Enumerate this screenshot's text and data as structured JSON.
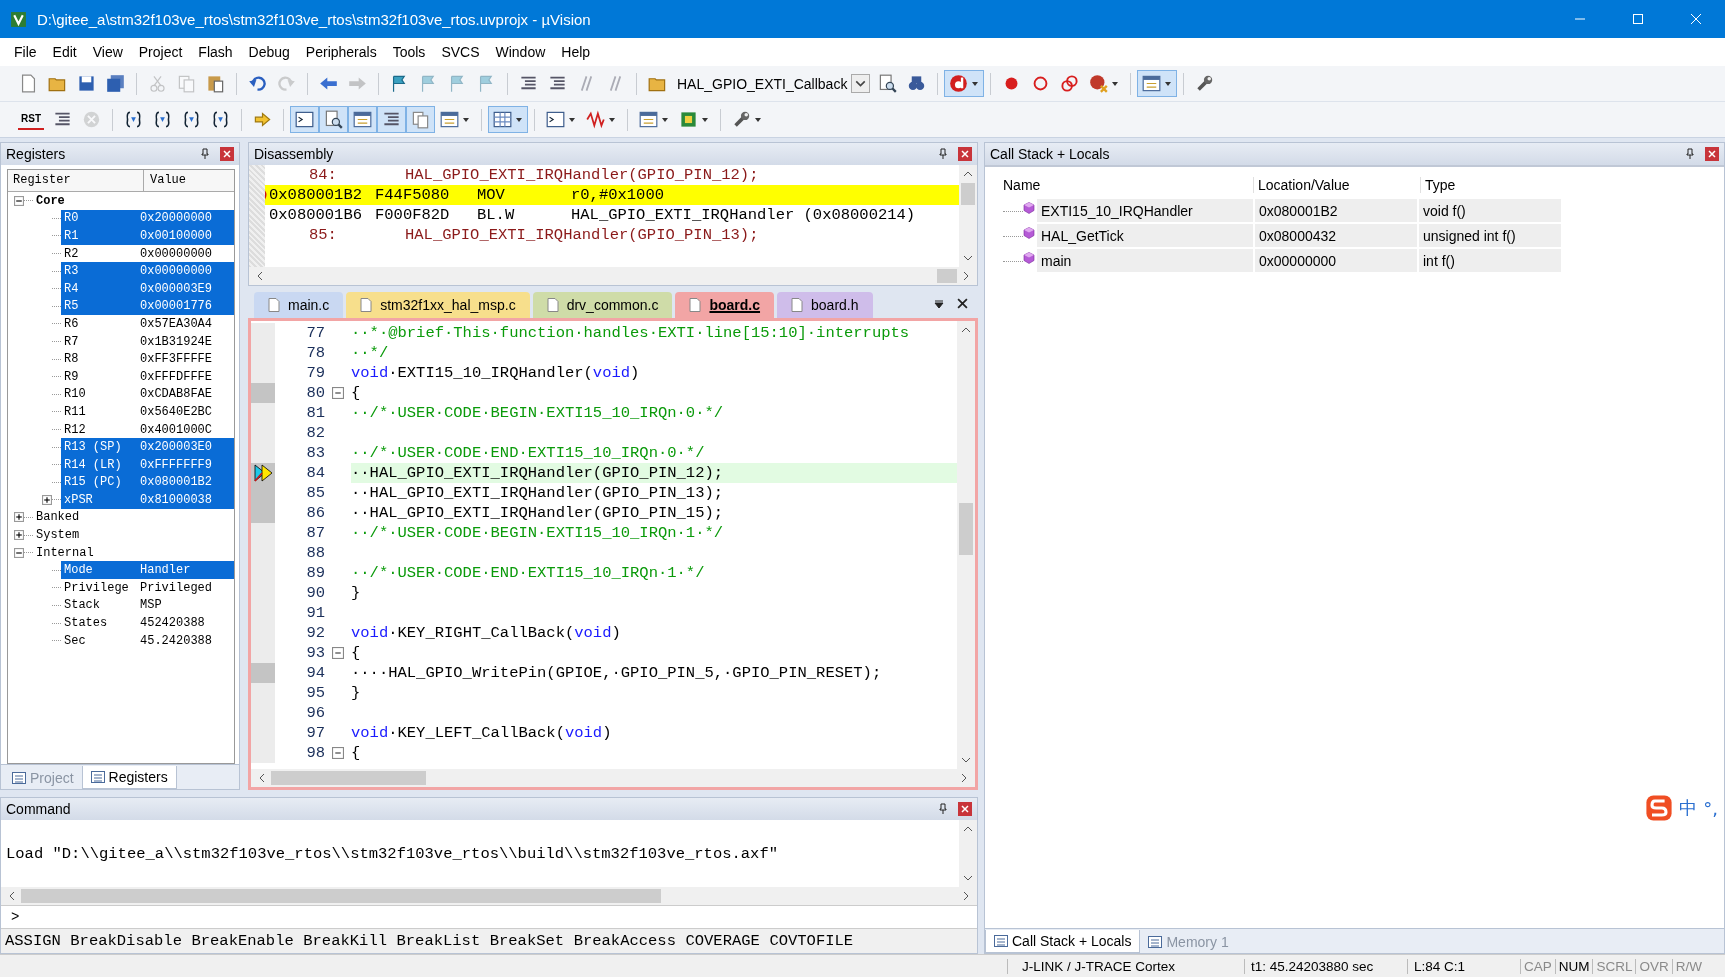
{
  "window": {
    "title": "D:\\gitee_a\\stm32f103ve_rtos\\stm32f103ve_rtos\\stm32f103ve_rtos.uvprojx - µVision"
  },
  "menu": [
    "File",
    "Edit",
    "View",
    "Project",
    "Flash",
    "Debug",
    "Peripherals",
    "Tools",
    "SVCS",
    "Window",
    "Help"
  ],
  "toolbar": {
    "function_combo": "HAL_GPIO_EXTI_Callback",
    "reset_label": "RST"
  },
  "registers": {
    "title": "Registers",
    "columns": [
      "Register",
      "Value"
    ],
    "tree": [
      {
        "name": "Core",
        "bold": true,
        "expanded": true,
        "selected": false,
        "children": [
          {
            "name": "R0",
            "value": "0x20000000",
            "selected": true
          },
          {
            "name": "R1",
            "value": "0x00100000",
            "selected": true
          },
          {
            "name": "R2",
            "value": "0x00000000",
            "selected": false
          },
          {
            "name": "R3",
            "value": "0x00000000",
            "selected": true
          },
          {
            "name": "R4",
            "value": "0x000003E9",
            "selected": true
          },
          {
            "name": "R5",
            "value": "0x00001776",
            "selected": true
          },
          {
            "name": "R6",
            "value": "0x57EA30A4",
            "selected": false
          },
          {
            "name": "R7",
            "value": "0x1B31924E",
            "selected": false
          },
          {
            "name": "R8",
            "value": "0xFF3FFFFE",
            "selected": false
          },
          {
            "name": "R9",
            "value": "0xFFFDFFFE",
            "selected": false
          },
          {
            "name": "R10",
            "value": "0xCDAB8FAE",
            "selected": false
          },
          {
            "name": "R11",
            "value": "0x5640E2BC",
            "selected": false
          },
          {
            "name": "R12",
            "value": "0x4001000C",
            "selected": false
          },
          {
            "name": "R13 (SP)",
            "value": "0x200003E0",
            "selected": true
          },
          {
            "name": "R14 (LR)",
            "value": "0xFFFFFFF9",
            "selected": true
          },
          {
            "name": "R15 (PC)",
            "value": "0x080001B2",
            "selected": true
          },
          {
            "name": "xPSR",
            "value": "0x81000038",
            "selected": true,
            "expanded": false
          }
        ]
      },
      {
        "name": "Banked",
        "bold": false,
        "expanded": false,
        "selected": false
      },
      {
        "name": "System",
        "bold": false,
        "expanded": false,
        "selected": false
      },
      {
        "name": "Internal",
        "bold": false,
        "expanded": true,
        "selected": false,
        "children": [
          {
            "name": "Mode",
            "value": "Handler",
            "selected": true
          },
          {
            "name": "Privilege",
            "value": "Privileged",
            "selected": false
          },
          {
            "name": "Stack",
            "value": "MSP",
            "selected": false
          },
          {
            "name": "States",
            "value": "452420388",
            "selected": false
          },
          {
            "name": "Sec",
            "value": "45.2420388",
            "selected": false
          }
        ]
      }
    ],
    "tabs": [
      {
        "label": "Project",
        "selected": false
      },
      {
        "label": "Registers",
        "selected": true
      }
    ]
  },
  "disassembly": {
    "title": "Disassembly",
    "lines": [
      {
        "kind": "source",
        "number": "84:",
        "text": "HAL_GPIO_EXTI_IRQHandler(GPIO_PIN_12);",
        "current": false
      },
      {
        "kind": "asm",
        "address": "0x080001B2",
        "opcode": "F44F5080",
        "mnemonic": "MOV",
        "operands": "r0,#0x1000",
        "current": true
      },
      {
        "kind": "asm",
        "address": "0x080001B6",
        "opcode": "F000F82D",
        "mnemonic": "BL.W",
        "operands": "HAL_GPIO_EXTI_IRQHandler (0x08000214)",
        "current": false
      },
      {
        "kind": "source",
        "number": "85:",
        "text": "HAL_GPIO_EXTI_IRQHandler(GPIO_PIN_13);",
        "current": false
      }
    ]
  },
  "editor": {
    "tabs": [
      {
        "label": "main.c",
        "color": "#c9d8f2",
        "selected": false
      },
      {
        "label": "stm32f1xx_hal_msp.c",
        "color": "#f7df8c",
        "selected": false
      },
      {
        "label": "drv_common.c",
        "color": "#cfdca8",
        "selected": false
      },
      {
        "label": "board.c",
        "color": "#f2a5a5",
        "selected": true
      },
      {
        "label": "board.h",
        "color": "#cfbdea",
        "selected": false
      }
    ],
    "lines": [
      {
        "number": "77",
        "executable": false,
        "fold": false,
        "current": false,
        "segments": [
          {
            "kind": "comment",
            "text": "··*·@brief·This·function·handles·EXTI·line[15:10]·interrupts"
          }
        ]
      },
      {
        "number": "78",
        "executable": false,
        "fold": false,
        "current": false,
        "segments": [
          {
            "kind": "comment",
            "text": "··*/"
          }
        ]
      },
      {
        "number": "79",
        "executable": false,
        "fold": false,
        "current": false,
        "segments": [
          {
            "kind": "keyword",
            "text": "void"
          },
          {
            "kind": "plain",
            "text": "·EXTI15_10_IRQHandler("
          },
          {
            "kind": "keyword",
            "text": "void"
          },
          {
            "kind": "plain",
            "text": ")"
          }
        ]
      },
      {
        "number": "80",
        "executable": true,
        "fold": true,
        "current": false,
        "segments": [
          {
            "kind": "plain",
            "text": "{"
          }
        ]
      },
      {
        "number": "81",
        "executable": false,
        "fold": false,
        "current": false,
        "segments": [
          {
            "kind": "comment",
            "text": "··/*·USER·CODE·BEGIN·EXTI15_10_IRQn·0·*/"
          }
        ]
      },
      {
        "number": "82",
        "executable": false,
        "fold": false,
        "current": false
      },
      {
        "number": "83",
        "executable": false,
        "fold": false,
        "current": false,
        "segments": [
          {
            "kind": "comment",
            "text": "··/*·USER·CODE·END·EXTI15_10_IRQn·0·*/"
          }
        ]
      },
      {
        "number": "84",
        "executable": true,
        "fold": false,
        "current": true,
        "segments": [
          {
            "kind": "plain",
            "text": "··HAL_GPIO_EXTI_IRQHandler(GPIO_PIN_12);"
          }
        ]
      },
      {
        "number": "85",
        "executable": true,
        "fold": false,
        "current": false,
        "segments": [
          {
            "kind": "plain",
            "text": "··HAL_GPIO_EXTI_IRQHandler(GPIO_PIN_13);"
          }
        ]
      },
      {
        "number": "86",
        "executable": true,
        "fold": false,
        "current": false,
        "segments": [
          {
            "kind": "plain",
            "text": "··HAL_GPIO_EXTI_IRQHandler(GPIO_PIN_15);"
          }
        ]
      },
      {
        "number": "87",
        "executable": false,
        "fold": false,
        "current": false,
        "segments": [
          {
            "kind": "comment",
            "text": "··/*·USER·CODE·BEGIN·EXTI15_10_IRQn·1·*/"
          }
        ]
      },
      {
        "number": "88",
        "executable": false,
        "fold": false,
        "current": false
      },
      {
        "number": "89",
        "executable": false,
        "fold": false,
        "current": false,
        "segments": [
          {
            "kind": "comment",
            "text": "··/*·USER·CODE·END·EXTI15_10_IRQn·1·*/"
          }
        ]
      },
      {
        "number": "90",
        "executable": false,
        "fold": false,
        "current": false,
        "segments": [
          {
            "kind": "plain",
            "text": "}"
          }
        ]
      },
      {
        "number": "91",
        "executable": false,
        "fold": false,
        "current": false
      },
      {
        "number": "92",
        "executable": false,
        "fold": false,
        "current": false,
        "segments": [
          {
            "kind": "keyword",
            "text": "void"
          },
          {
            "kind": "plain",
            "text": "·KEY_RIGHT_CallBack("
          },
          {
            "kind": "keyword",
            "text": "void"
          },
          {
            "kind": "plain",
            "text": ")"
          }
        ]
      },
      {
        "number": "93",
        "executable": false,
        "fold": true,
        "current": false,
        "segments": [
          {
            "kind": "plain",
            "text": "{"
          }
        ]
      },
      {
        "number": "94",
        "executable": true,
        "fold": false,
        "current": false,
        "segments": [
          {
            "kind": "plain",
            "text": "····HAL_GPIO_WritePin(GPIOE,·GPIO_PIN_5,·GPIO_PIN_RESET);"
          }
        ]
      },
      {
        "number": "95",
        "executable": false,
        "fold": false,
        "current": false,
        "segments": [
          {
            "kind": "plain",
            "text": "}"
          }
        ]
      },
      {
        "number": "96",
        "executable": false,
        "fold": false,
        "current": false
      },
      {
        "number": "97",
        "executable": false,
        "fold": false,
        "current": false,
        "segments": [
          {
            "kind": "keyword",
            "text": "void"
          },
          {
            "kind": "plain",
            "text": "·KEY_LEFT_CallBack("
          },
          {
            "kind": "keyword",
            "text": "void"
          },
          {
            "kind": "plain",
            "text": ")"
          }
        ]
      },
      {
        "number": "98",
        "executable": false,
        "fold": true,
        "current": false,
        "segments": [
          {
            "kind": "plain",
            "text": "{"
          }
        ]
      }
    ]
  },
  "command": {
    "title": "Command",
    "output": "Load \"D:\\\\gitee_a\\\\stm32f103ve_rtos\\\\stm32f103ve_rtos\\\\build\\\\stm32f103ve_rtos.axf\"",
    "prompt": ">",
    "keywords": [
      "ASSIGN",
      "BreakDisable",
      "BreakEnable",
      "BreakKill",
      "BreakList",
      "BreakSet",
      "BreakAccess",
      "COVERAGE",
      "COVTOFILE"
    ]
  },
  "call_stack": {
    "title": "Call Stack + Locals",
    "columns": [
      "Name",
      "Location/Value",
      "Type"
    ],
    "rows": [
      {
        "name": "EXTI15_10_IRQHandler",
        "location": "0x080001B2",
        "type": "void f()"
      },
      {
        "name": "HAL_GetTick",
        "location": "0x08000432",
        "type": "unsigned int f()"
      },
      {
        "name": "main",
        "location": "0x00000000",
        "type": "int f()"
      }
    ],
    "tabs": [
      {
        "label": "Call Stack + Locals",
        "selected": true
      },
      {
        "label": "Memory 1",
        "selected": false
      }
    ]
  },
  "status_bar": {
    "target": "J-LINK / J-TRACE Cortex",
    "time": "t1: 45.24203880 sec",
    "position": "L:84 C:1",
    "indicators": [
      {
        "label": "CAP",
        "on": false
      },
      {
        "label": "NUM",
        "on": true
      },
      {
        "label": "SCRL",
        "on": false
      },
      {
        "label": "OVR",
        "on": false
      },
      {
        "label": "R/W",
        "on": false
      }
    ]
  },
  "ime": {
    "labels": [
      "中",
      "°,"
    ]
  }
}
